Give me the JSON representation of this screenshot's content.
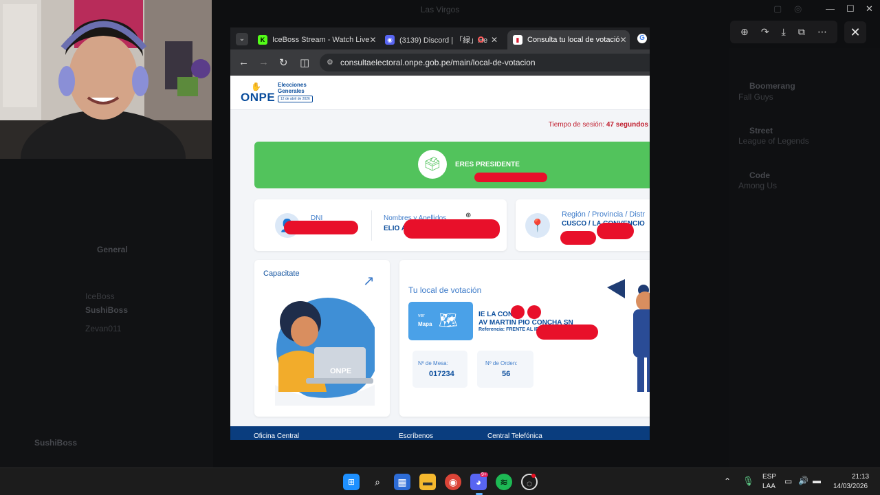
{
  "viewer": {
    "title": "Las Virgos",
    "close_icon": "close-icon"
  },
  "discord_bg": {
    "channels": [
      "General",
      "IceBoss",
      "SushiBoss",
      "Zevan011"
    ],
    "right_items": [
      "Boomerang",
      "Fall Guys",
      "Street",
      "League of Legends",
      "Code",
      "Among Us"
    ],
    "user": "SushiBoss"
  },
  "browser": {
    "tabs": [
      {
        "label": "IceBoss Stream - Watch Live"
      },
      {
        "label": "(3139) Discord | 「緑」He"
      },
      {
        "label": "Consulta tu local de votació"
      }
    ],
    "url": "consultaelectoral.onpe.gob.pe/main/local-de-votacion"
  },
  "page": {
    "logo": {
      "brand": "ONPE",
      "line1": "Elecciones",
      "line2": "Generales",
      "date": "12 de abril de 2026"
    },
    "session_label": "Tiempo de sesión:",
    "session_value": "47 segundos",
    "banner": "ERES PRESIDENTE",
    "dni_label": "DNI",
    "names_label": "Nombres y Apellidos",
    "names_value": "ELIO A",
    "region_label": "Región / Provincia / Distr",
    "region_value": "CUSCO / LA CONVENCIO",
    "capacitate": "Capacitate",
    "local_title": "Tu local de votación",
    "map_btn_top": "ver",
    "map_btn": "Mapa",
    "school": "IE LA CON",
    "address": "AV MARTIN PIO CONCHA SN",
    "reference": "Referencia: FRENTE AL IESP",
    "mesa_label": "Nº de Mesa:",
    "mesa_value": "017234",
    "orden_label": "Nº de Orden:",
    "orden_value": "56",
    "laptop_brand": "ONPE",
    "footer": [
      "Oficina Central",
      "Escríbenos",
      "Central Telefónica"
    ]
  },
  "taskbar": {
    "lang1": "ESP",
    "lang2": "LAA",
    "time": "21:13",
    "date": "14/03/2026",
    "discord_badge": "9+"
  }
}
